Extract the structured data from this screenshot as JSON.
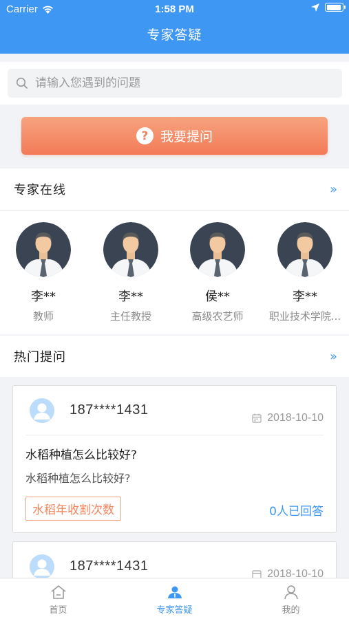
{
  "status_bar": {
    "carrier": "Carrier",
    "time": "1:58 PM"
  },
  "nav": {
    "title": "专家答疑"
  },
  "search": {
    "placeholder": "请输入您遇到的问题"
  },
  "ask_button": {
    "icon_text": "?",
    "label": "我要提问"
  },
  "experts_section": {
    "title": "专家在线",
    "more_icon": "double-chevron-right-icon",
    "experts": [
      {
        "name": "李**",
        "role": "教师"
      },
      {
        "name": "李**",
        "role": "主任教授"
      },
      {
        "name": "侯**",
        "role": "高级农艺师"
      },
      {
        "name": "李**",
        "role": "职业技术学院..."
      }
    ]
  },
  "hot_section": {
    "title": "热门提问",
    "more_icon": "double-chevron-right-icon",
    "questions": [
      {
        "phone": "187****1431",
        "date": "2018-10-10",
        "title": "水稻种植怎么比较好?",
        "desc": "水稻种植怎么比较好?",
        "tag": "水稻年收割次数",
        "answers": "0人已回答"
      },
      {
        "phone": "187****1431",
        "date": "2018-10-10"
      }
    ]
  },
  "tabbar": {
    "tabs": [
      {
        "label": "首页",
        "icon": "home-icon"
      },
      {
        "label": "专家答疑",
        "icon": "expert-icon"
      },
      {
        "label": "我的",
        "icon": "user-icon"
      }
    ]
  },
  "colors": {
    "primary": "#3f97f4",
    "accent": "#f47a58",
    "background": "#f2f3f7"
  }
}
